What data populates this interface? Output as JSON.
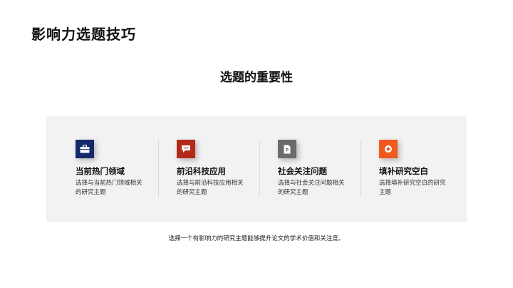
{
  "slide": {
    "title": "影响力选题技巧",
    "section_title": "选题的重要性",
    "footer": "选择一个有影响力的研究主题能够提升论文的学术价值和关注度。"
  },
  "cards": [
    {
      "label": "当前热门领域",
      "desc": "选择与当前热门领域相关的研究主题",
      "icon": "briefcase-icon",
      "color": "#13296b"
    },
    {
      "label": "前沿科技应用",
      "desc": "选择与前沿科技应用相关的研究主题",
      "icon": "chat-bubble-icon",
      "color": "#b22a17"
    },
    {
      "label": "社会关注问题",
      "desc": "选择与社会关注问题相关的研究主题",
      "icon": "document-icon",
      "color": "#6b6b6b"
    },
    {
      "label": "填补研究空白",
      "desc": "选择填补研究空白的研究主题",
      "icon": "target-icon",
      "color": "#f05a1e"
    }
  ]
}
